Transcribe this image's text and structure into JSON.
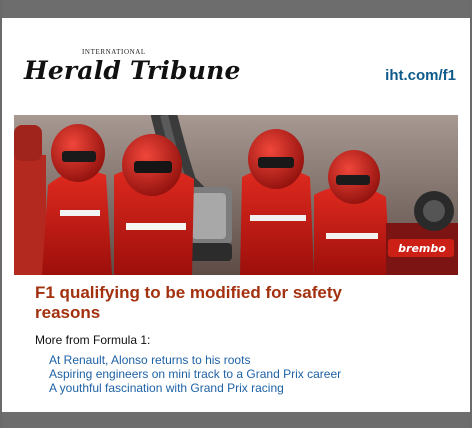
{
  "masthead": {
    "international": "INTERNATIONAL",
    "name": "Herald Tribune",
    "link": "iht.com/f1"
  },
  "photo": {
    "subject": "Ferrari pit crew in red suits and helmets during refuelling",
    "sign_text": "brembo"
  },
  "article": {
    "headline": "F1 qualifying to be modified for safety reasons",
    "more_label": "More from Formula 1:",
    "links": [
      "At Renault, Alonso returns to his roots",
      "Aspiring engineers on mini track to a Grand Prix career",
      "A youthful fascination with Grand Prix racing"
    ]
  },
  "colors": {
    "frame": "#6d6d6d",
    "headline": "#a3310e",
    "link": "#1e62a6",
    "masthead_link": "#0e5a8a"
  }
}
